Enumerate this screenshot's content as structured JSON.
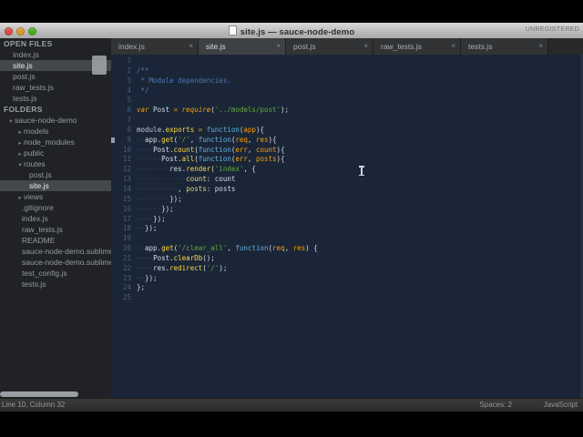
{
  "titlebar": {
    "title": "site.js — sauce-node-demo",
    "unregistered": "UNREGISTERED"
  },
  "tabs": [
    {
      "label": "index.js",
      "active": false
    },
    {
      "label": "site.js",
      "active": true
    },
    {
      "label": "post.js",
      "active": false
    },
    {
      "label": "raw_tests.js",
      "active": false
    },
    {
      "label": "tests.js",
      "active": false
    }
  ],
  "sidebar": {
    "open_files_header": "OPEN FILES",
    "open_files": [
      {
        "label": "index.js",
        "selected": false
      },
      {
        "label": "site.js",
        "selected": true
      },
      {
        "label": "post.js",
        "selected": false
      },
      {
        "label": "raw_tests.js",
        "selected": false
      },
      {
        "label": "tests.js",
        "selected": false
      }
    ],
    "folders_header": "FOLDERS",
    "tree": [
      {
        "label": "sauce-node-demo",
        "arrow": "open",
        "indent": 0,
        "selected": false
      },
      {
        "label": "models",
        "arrow": "closed",
        "indent": 1,
        "selected": false
      },
      {
        "label": "node_modules",
        "arrow": "closed",
        "indent": 1,
        "selected": false
      },
      {
        "label": "public",
        "arrow": "closed",
        "indent": 1,
        "selected": false
      },
      {
        "label": "routes",
        "arrow": "open",
        "indent": 1,
        "selected": false
      },
      {
        "label": "post.js",
        "arrow": null,
        "indent": 2,
        "selected": false
      },
      {
        "label": "site.js",
        "arrow": null,
        "indent": 2,
        "selected": true
      },
      {
        "label": "views",
        "arrow": "closed",
        "indent": 1,
        "selected": false
      },
      {
        "label": ".gitignore",
        "arrow": null,
        "indent": 1,
        "selected": false
      },
      {
        "label": "index.js",
        "arrow": null,
        "indent": 1,
        "selected": false
      },
      {
        "label": "raw_tests.js",
        "arrow": null,
        "indent": 1,
        "selected": false
      },
      {
        "label": "README",
        "arrow": null,
        "indent": 1,
        "selected": false
      },
      {
        "label": "sauce-node-demo.sublime-proj",
        "arrow": null,
        "indent": 1,
        "selected": false
      },
      {
        "label": "sauce-node-demo.sublime-wor",
        "arrow": null,
        "indent": 1,
        "selected": false
      },
      {
        "label": "test_config.js",
        "arrow": null,
        "indent": 1,
        "selected": false
      },
      {
        "label": "tests.js",
        "arrow": null,
        "indent": 1,
        "selected": false
      }
    ]
  },
  "editor": {
    "token_colors": {
      "comment": "#4a79b3",
      "keyword": "#ff9d00",
      "function": "#62b1e0",
      "string": "#66a83d",
      "method": "#ffd945",
      "param": "#ff9d00",
      "plain": "#d7dce2",
      "key": "#e3d283",
      "module": "#c0c6cd",
      "whitespace": "rgba(170,200,255,0.22)"
    },
    "lines": [
      {
        "num": 1,
        "tokens": []
      },
      {
        "num": 2,
        "tokens": [
          [
            "/**",
            "comment"
          ]
        ]
      },
      {
        "num": 3,
        "tokens": [
          [
            " * Module dependencies.",
            "comment"
          ]
        ]
      },
      {
        "num": 4,
        "tokens": [
          [
            " */",
            "comment"
          ]
        ]
      },
      {
        "num": 5,
        "tokens": []
      },
      {
        "num": 6,
        "tokens": [
          [
            "var",
            "keyword"
          ],
          [
            " Post ",
            "plain"
          ],
          [
            "=",
            "keyword"
          ],
          [
            " ",
            "plain"
          ],
          [
            "require",
            "keyword"
          ],
          [
            "(",
            "plain"
          ],
          [
            "'../models/post'",
            "string"
          ],
          [
            ");",
            "plain"
          ]
        ]
      },
      {
        "num": 7,
        "tokens": []
      },
      {
        "num": 8,
        "tokens": [
          [
            "module",
            "module"
          ],
          [
            ".",
            "plain"
          ],
          [
            "exports",
            "method"
          ],
          [
            " ",
            "plain"
          ],
          [
            "=",
            "keyword"
          ],
          [
            " ",
            "plain"
          ],
          [
            "function",
            "function"
          ],
          [
            "(",
            "plain"
          ],
          [
            "app",
            "param"
          ],
          [
            "){",
            "plain"
          ]
        ]
      },
      {
        "num": 9,
        "tokens": [
          [
            "··",
            "whitespace"
          ],
          [
            "app.",
            "plain"
          ],
          [
            "get",
            "method"
          ],
          [
            "(",
            "plain"
          ],
          [
            "'/'",
            "string"
          ],
          [
            ", ",
            "plain"
          ],
          [
            "function",
            "function"
          ],
          [
            "(",
            "plain"
          ],
          [
            "req",
            "param"
          ],
          [
            ", ",
            "plain"
          ],
          [
            "res",
            "param"
          ],
          [
            "){",
            "plain"
          ]
        ]
      },
      {
        "num": 10,
        "tokens": [
          [
            "····",
            "whitespace"
          ],
          [
            "Post.",
            "plain"
          ],
          [
            "count",
            "method"
          ],
          [
            "(",
            "plain"
          ],
          [
            "function",
            "function"
          ],
          [
            "(",
            "plain"
          ],
          [
            "err",
            "param"
          ],
          [
            ", ",
            "plain"
          ],
          [
            "count",
            "param"
          ],
          [
            "){",
            "plain"
          ]
        ]
      },
      {
        "num": 11,
        "tokens": [
          [
            "······",
            "whitespace"
          ],
          [
            "Post.",
            "plain"
          ],
          [
            "all",
            "method"
          ],
          [
            "(",
            "plain"
          ],
          [
            "function",
            "function"
          ],
          [
            "(",
            "plain"
          ],
          [
            "err",
            "param"
          ],
          [
            ", ",
            "plain"
          ],
          [
            "posts",
            "param"
          ],
          [
            "){",
            "plain"
          ]
        ]
      },
      {
        "num": 12,
        "tokens": [
          [
            "········",
            "whitespace"
          ],
          [
            "res.",
            "plain"
          ],
          [
            "render",
            "method"
          ],
          [
            "(",
            "plain"
          ],
          [
            "'index'",
            "string"
          ],
          [
            ", {",
            "plain"
          ]
        ]
      },
      {
        "num": 13,
        "tokens": [
          [
            "············",
            "whitespace"
          ],
          [
            "count",
            "key"
          ],
          [
            ": ",
            "plain"
          ],
          [
            "count",
            "plain"
          ]
        ]
      },
      {
        "num": 14,
        "tokens": [
          [
            "··········",
            "whitespace"
          ],
          [
            ", ",
            "plain"
          ],
          [
            "posts",
            "key"
          ],
          [
            ": ",
            "plain"
          ],
          [
            "posts",
            "plain"
          ]
        ]
      },
      {
        "num": 15,
        "tokens": [
          [
            "········",
            "whitespace"
          ],
          [
            "});",
            "plain"
          ]
        ]
      },
      {
        "num": 16,
        "tokens": [
          [
            "······",
            "whitespace"
          ],
          [
            "});",
            "plain"
          ]
        ]
      },
      {
        "num": 17,
        "tokens": [
          [
            "····",
            "whitespace"
          ],
          [
            "});",
            "plain"
          ]
        ]
      },
      {
        "num": 18,
        "tokens": [
          [
            "··",
            "whitespace"
          ],
          [
            "});",
            "plain"
          ]
        ]
      },
      {
        "num": 19,
        "tokens": []
      },
      {
        "num": 20,
        "tokens": [
          [
            "··",
            "whitespace"
          ],
          [
            "app.",
            "plain"
          ],
          [
            "get",
            "method"
          ],
          [
            "(",
            "plain"
          ],
          [
            "'/clear_all'",
            "string"
          ],
          [
            ", ",
            "plain"
          ],
          [
            "function",
            "function"
          ],
          [
            "(",
            "plain"
          ],
          [
            "req",
            "param"
          ],
          [
            ", ",
            "plain"
          ],
          [
            "res",
            "param"
          ],
          [
            ") {",
            "plain"
          ]
        ]
      },
      {
        "num": 21,
        "tokens": [
          [
            "····",
            "whitespace"
          ],
          [
            "Post.",
            "plain"
          ],
          [
            "clearDb",
            "method"
          ],
          [
            "();",
            "plain"
          ]
        ]
      },
      {
        "num": 22,
        "tokens": [
          [
            "····",
            "whitespace"
          ],
          [
            "res.",
            "plain"
          ],
          [
            "redirect",
            "method"
          ],
          [
            "(",
            "plain"
          ],
          [
            "'/'",
            "string"
          ],
          [
            ");",
            "plain"
          ]
        ]
      },
      {
        "num": 23,
        "tokens": [
          [
            "··",
            "whitespace"
          ],
          [
            "});",
            "plain"
          ]
        ]
      },
      {
        "num": 24,
        "tokens": [
          [
            "};",
            "plain"
          ]
        ]
      },
      {
        "num": 25,
        "tokens": []
      }
    ]
  },
  "statusbar": {
    "position": "Line 10, Column 32",
    "spaces": "Spaces: 2",
    "syntax": "JavaScript"
  }
}
